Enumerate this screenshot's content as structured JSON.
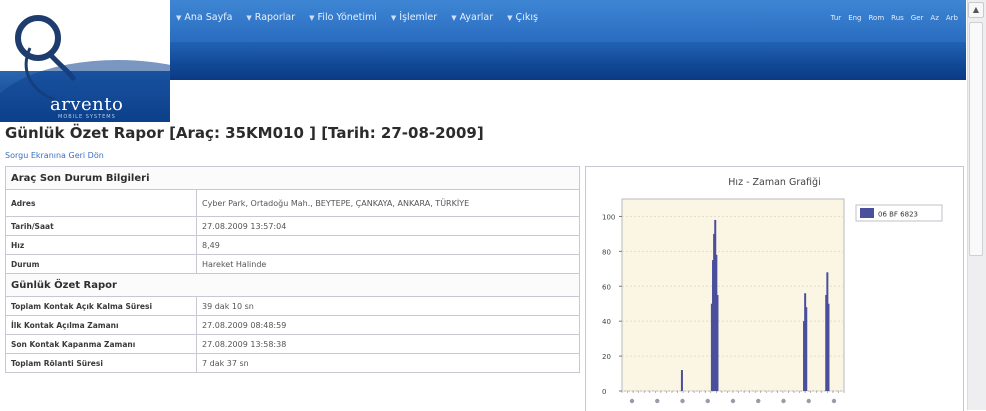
{
  "brand": {
    "logo_text": "arvento",
    "logo_subtext": "MOBILE SYSTEMS"
  },
  "nav": {
    "items": [
      {
        "label": "Ana Sayfa"
      },
      {
        "label": "Raporlar"
      },
      {
        "label": "Filo Yönetimi"
      },
      {
        "label": "İşlemler"
      },
      {
        "label": "Ayarlar"
      },
      {
        "label": "Çıkış"
      }
    ],
    "languages": [
      "Tur",
      "Eng",
      "Rom",
      "Rus",
      "Ger",
      "Az",
      "Arb"
    ]
  },
  "page": {
    "title": "Günlük Özet Rapor [Araç: 35KM010 ] [Tarih: 27-08-2009]",
    "back_link": "Sorgu Ekranına Geri Dön"
  },
  "status_section": {
    "heading": "Araç Son Durum Bilgileri",
    "rows": [
      {
        "label": "Adres",
        "value": "Cyber Park, Ortadoğu Mah., BEYTEPE, ÇANKAYA, ANKARA, TÜRKİYE"
      },
      {
        "label": "Tarih/Saat",
        "value": "27.08.2009 13:57:04"
      },
      {
        "label": "Hız",
        "value": "8,49"
      },
      {
        "label": "Durum",
        "value": "Hareket Halinde"
      }
    ]
  },
  "summary_section": {
    "heading": "Günlük Özet Rapor",
    "rows": [
      {
        "label": "Toplam Kontak Açık Kalma Süresi",
        "value": "39 dak 10 sn"
      },
      {
        "label": "İlk Kontak Açılma Zamanı",
        "value": "27.08.2009 08:48:59"
      },
      {
        "label": "Son Kontak Kapanma Zamanı",
        "value": "27.08.2009 13:58:38"
      },
      {
        "label": "Toplam Rölanti Süresi",
        "value": "7 dak 37 sn"
      }
    ]
  },
  "colors": {
    "header_blue": "#2a6cc0",
    "bar_color": "#4a4f9c",
    "plot_bg": "#fbf5e4"
  },
  "chart_data": {
    "type": "bar",
    "title": "Hız - Zaman Grafiği",
    "legend": [
      "06 BF 6823"
    ],
    "legend_position": "top-right",
    "ylim": [
      0,
      110
    ],
    "yticks": [
      0,
      20,
      40,
      60,
      80,
      100
    ],
    "xlim": [
      0,
      100
    ],
    "series": [
      {
        "name": "06 BF 6823",
        "x": [
          27,
          40.5,
          41,
          41.5,
          42,
          42.5,
          43,
          82,
          82.5,
          83,
          92,
          92.5,
          93
        ],
        "values": [
          12,
          50,
          75,
          90,
          98,
          78,
          55,
          40,
          56,
          48,
          55,
          68,
          50
        ]
      }
    ]
  }
}
